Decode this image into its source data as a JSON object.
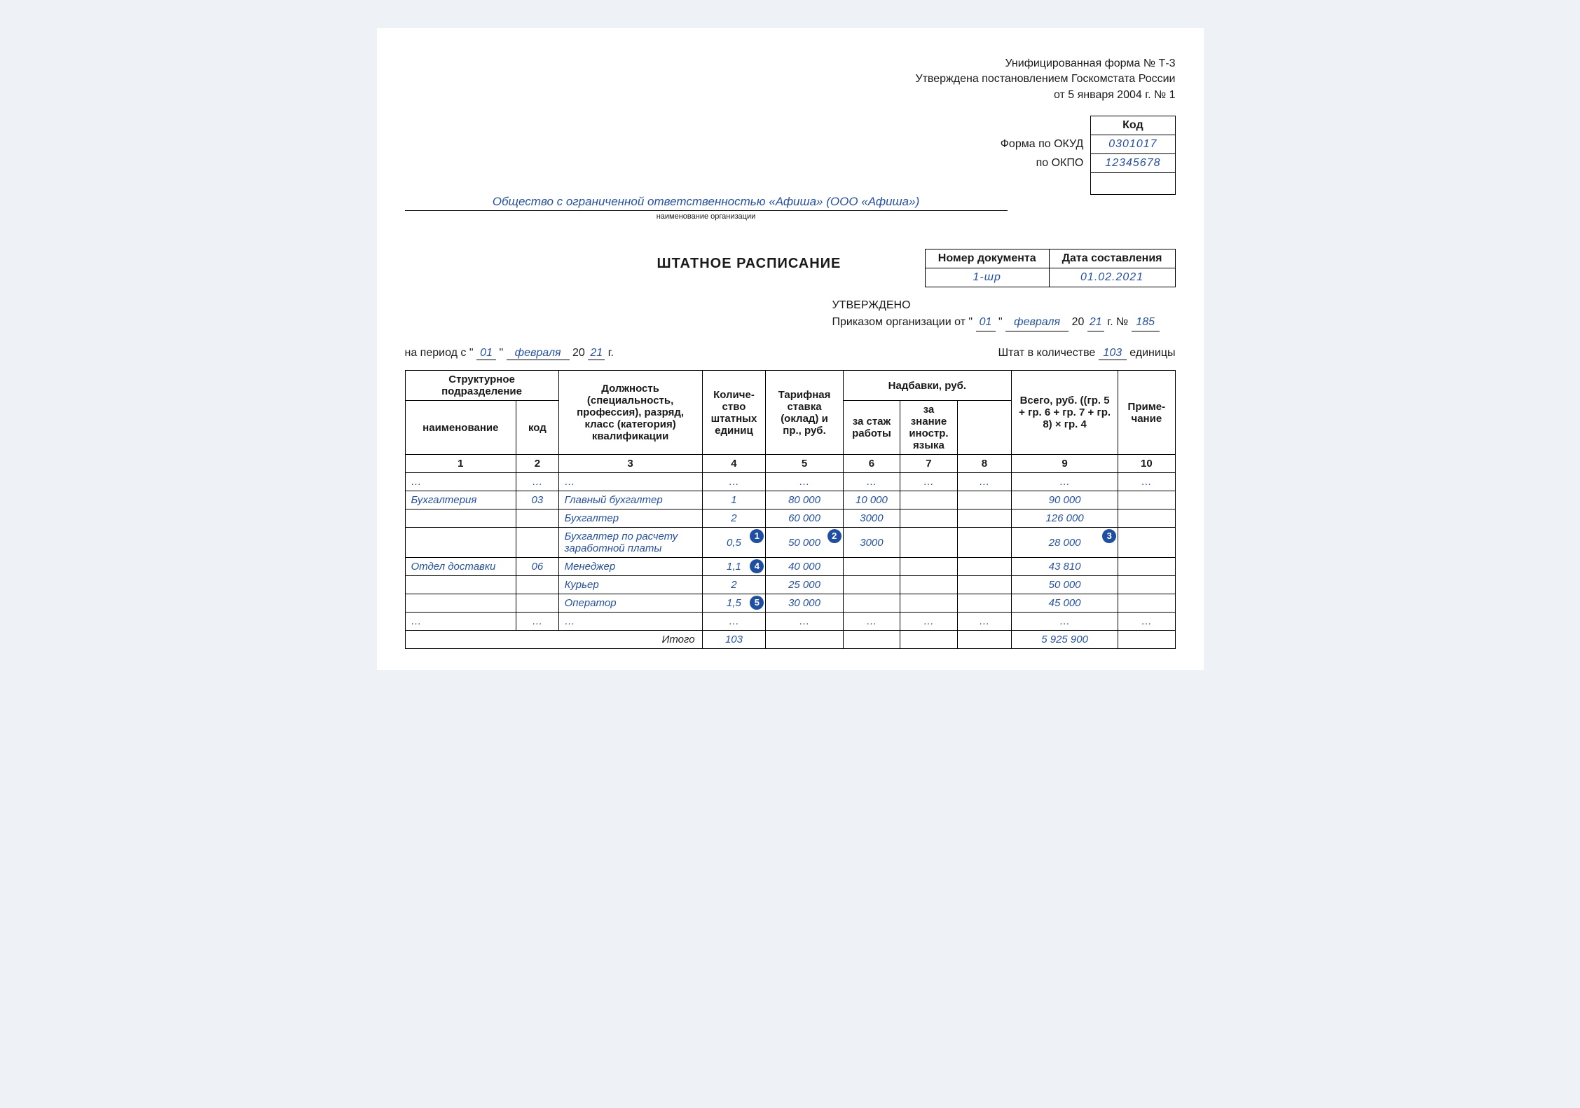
{
  "header": {
    "line1": "Унифицированная форма № Т-3",
    "line2": "Утверждена постановлением Госкомстата России",
    "line3": "от 5 января 2004 г. № 1"
  },
  "codebox": {
    "code_label": "Код",
    "okud_label": "Форма по ОКУД",
    "okud_value": "0301017",
    "okpo_label": "по ОКПО",
    "okpo_value": "12345678"
  },
  "org": {
    "name": "Общество с ограниченной ответственностью «Афиша» (ООО «Афиша»)",
    "sublabel": "наименование организации"
  },
  "docmeta": {
    "title": "ШТАТНОЕ РАСПИСАНИЕ",
    "docnum_header": "Номер документа",
    "docdate_header": "Дата составления",
    "docnum": "1-шр",
    "docdate": "01.02.2021"
  },
  "approval": {
    "line1": "УТВЕРЖДЕНО",
    "prefix": "Приказом организации от  \"",
    "day": "01",
    "quote2": "\" ",
    "month": "февраля",
    "year_prefix": " 20",
    "year": "21",
    "year_suffix": " г. № ",
    "order_no": "185"
  },
  "period": {
    "prefix": "на период  с \" ",
    "day": "01",
    "q2": "\"  ",
    "month": "февраля",
    "yp": " 20 ",
    "year": "21",
    "ys": " г."
  },
  "staff": {
    "prefix": "Штат в количестве ",
    "count": "103",
    "suffix": "  единицы"
  },
  "columns": {
    "struct": "Структурное подразделение",
    "name": "наименование",
    "code": "код",
    "position": "Должность (специальность, профессия), разряд, класс (категория) квалификации",
    "units": "Количе­ство штат­ных единиц",
    "rate": "Тарифная ставка (оклад) и пр., руб.",
    "allow": "Надбавки, руб.",
    "allow1": "за стаж работы",
    "allow2": "за знание иностр. языка",
    "allow3": "",
    "total": "Всего, руб. ((гр. 5 + гр. 6 + гр. 7 +  гр. 8) × гр. 4",
    "note": "Приме­чание",
    "n1": "1",
    "n2": "2",
    "n3": "3",
    "n4": "4",
    "n5": "5",
    "n6": "6",
    "n7": "7",
    "n8": "8",
    "n9": "9",
    "n10": "10"
  },
  "ellipsis": "…",
  "rows": [
    {
      "dept": "Бухгалтерия",
      "code": "03",
      "pos": "Главный бухгалтер",
      "units": "1",
      "rate": "80 000",
      "a1": "10 000",
      "a2": "",
      "a3": "",
      "total": "90 000",
      "note": ""
    },
    {
      "dept": "",
      "code": "",
      "pos": "Бухгалтер",
      "units": "2",
      "rate": "60 000",
      "a1": "3000",
      "a2": "",
      "a3": "",
      "total": "126 000",
      "note": ""
    },
    {
      "dept": "",
      "code": "",
      "pos": "Бухгалтер по расчету заработной платы",
      "units": "0,5",
      "rate": "50 000",
      "a1": "3000",
      "a2": "",
      "a3": "",
      "total": "28 000",
      "note": "",
      "badges": {
        "units": "1",
        "rate": "2",
        "total": "3"
      }
    },
    {
      "dept": "Отдел доставки",
      "code": "06",
      "pos": "Менеджер",
      "units": "1,1",
      "rate": "40 000",
      "a1": "",
      "a2": "",
      "a3": "",
      "total": "43 810",
      "note": "",
      "badges": {
        "units": "4"
      }
    },
    {
      "dept": "",
      "code": "",
      "pos": "Курьер",
      "units": "2",
      "rate": "25 000",
      "a1": "",
      "a2": "",
      "a3": "",
      "total": "50 000",
      "note": ""
    },
    {
      "dept": "",
      "code": "",
      "pos": "Оператор",
      "units": "1,5",
      "rate": "30 000",
      "a1": "",
      "a2": "",
      "a3": "",
      "total": "45 000",
      "note": "",
      "badges": {
        "units": "5"
      }
    }
  ],
  "totals": {
    "label": "Итого",
    "units": "103",
    "total": "5 925 900"
  }
}
